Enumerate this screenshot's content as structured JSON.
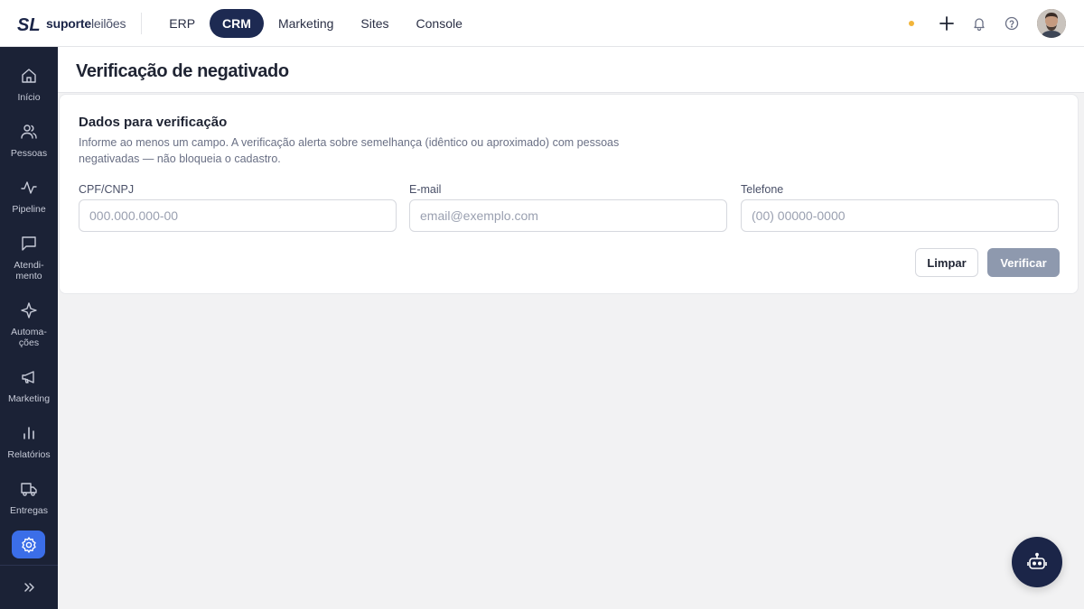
{
  "brand": {
    "bold": "suporte",
    "light": "leilões"
  },
  "nav": {
    "items": [
      {
        "label": "ERP",
        "active": false
      },
      {
        "label": "CRM",
        "active": true
      },
      {
        "label": "Marketing",
        "active": false
      },
      {
        "label": "Sites",
        "active": false
      },
      {
        "label": "Console",
        "active": false
      }
    ]
  },
  "topbar": {
    "icons": [
      "status-dot",
      "plus-icon",
      "bell-icon",
      "help-icon",
      "avatar"
    ],
    "status_color": "#f2b53a"
  },
  "sidebar": {
    "items": [
      {
        "label": "Início",
        "icon": "home-icon"
      },
      {
        "label": "Pessoas",
        "icon": "people-icon"
      },
      {
        "label": "Pipeline",
        "icon": "pulse-icon"
      },
      {
        "label": "Atendi-\nmento",
        "icon": "chat-icon"
      },
      {
        "label": "Automa-\nções",
        "icon": "sparkle-icon"
      },
      {
        "label": "Marketing",
        "icon": "megaphone-icon"
      },
      {
        "label": "Relatórios",
        "icon": "bar-chart-icon"
      },
      {
        "label": "Entregas",
        "icon": "truck-icon"
      }
    ],
    "active_icon": "gear-icon",
    "collapse_icon": "chevrons-right-icon",
    "accent": "#3b6ee8"
  },
  "page": {
    "title": "Verificação de negativado"
  },
  "card": {
    "title": "Dados para verificação",
    "description": "Informe ao menos um campo. A verificação alerta sobre semelhança (idêntico ou aproximado) com pessoas negativadas — não bloqueia o cadastro.",
    "fields": {
      "cpf": {
        "label": "CPF/CNPJ",
        "placeholder": "000.000.000-00",
        "value": ""
      },
      "email": {
        "label": "E-mail",
        "placeholder": "email@exemplo.com",
        "value": ""
      },
      "phone": {
        "label": "Telefone",
        "placeholder": "(00) 00000-0000",
        "value": ""
      }
    },
    "buttons": {
      "clear": "Limpar",
      "verify": "Verificar"
    }
  },
  "fab": {
    "icon": "robot-icon"
  },
  "colors": {
    "navy": "#1d2a52",
    "sidebar_bg": "#1b2236",
    "verify_btn": "#8e99ae"
  }
}
